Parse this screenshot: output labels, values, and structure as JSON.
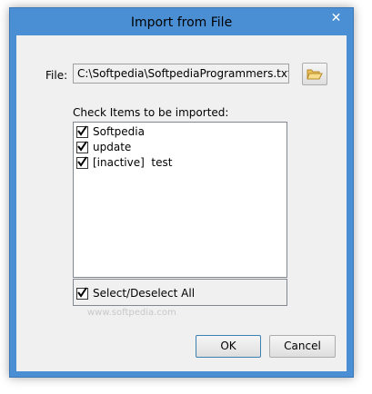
{
  "window": {
    "title": "Import from File",
    "close_glyph": "✕"
  },
  "file": {
    "label": "File:",
    "path": "C:\\Softpedia\\SoftpediaProgrammers.txt",
    "browse_icon": "folder-open-icon"
  },
  "items_section": {
    "label": "Check Items to be imported:",
    "items": [
      {
        "label": "Softpedia",
        "checked": true
      },
      {
        "label": "update",
        "checked": true
      },
      {
        "label": "[inactive]  test",
        "checked": true
      }
    ]
  },
  "select_all": {
    "label": "Select/Deselect All",
    "checked": true
  },
  "watermark": "www.softpedia.com",
  "buttons": {
    "ok_label": "OK",
    "cancel_label": "Cancel"
  },
  "colors": {
    "frame": "#4a8fd3",
    "client": "#f0f0f0"
  }
}
